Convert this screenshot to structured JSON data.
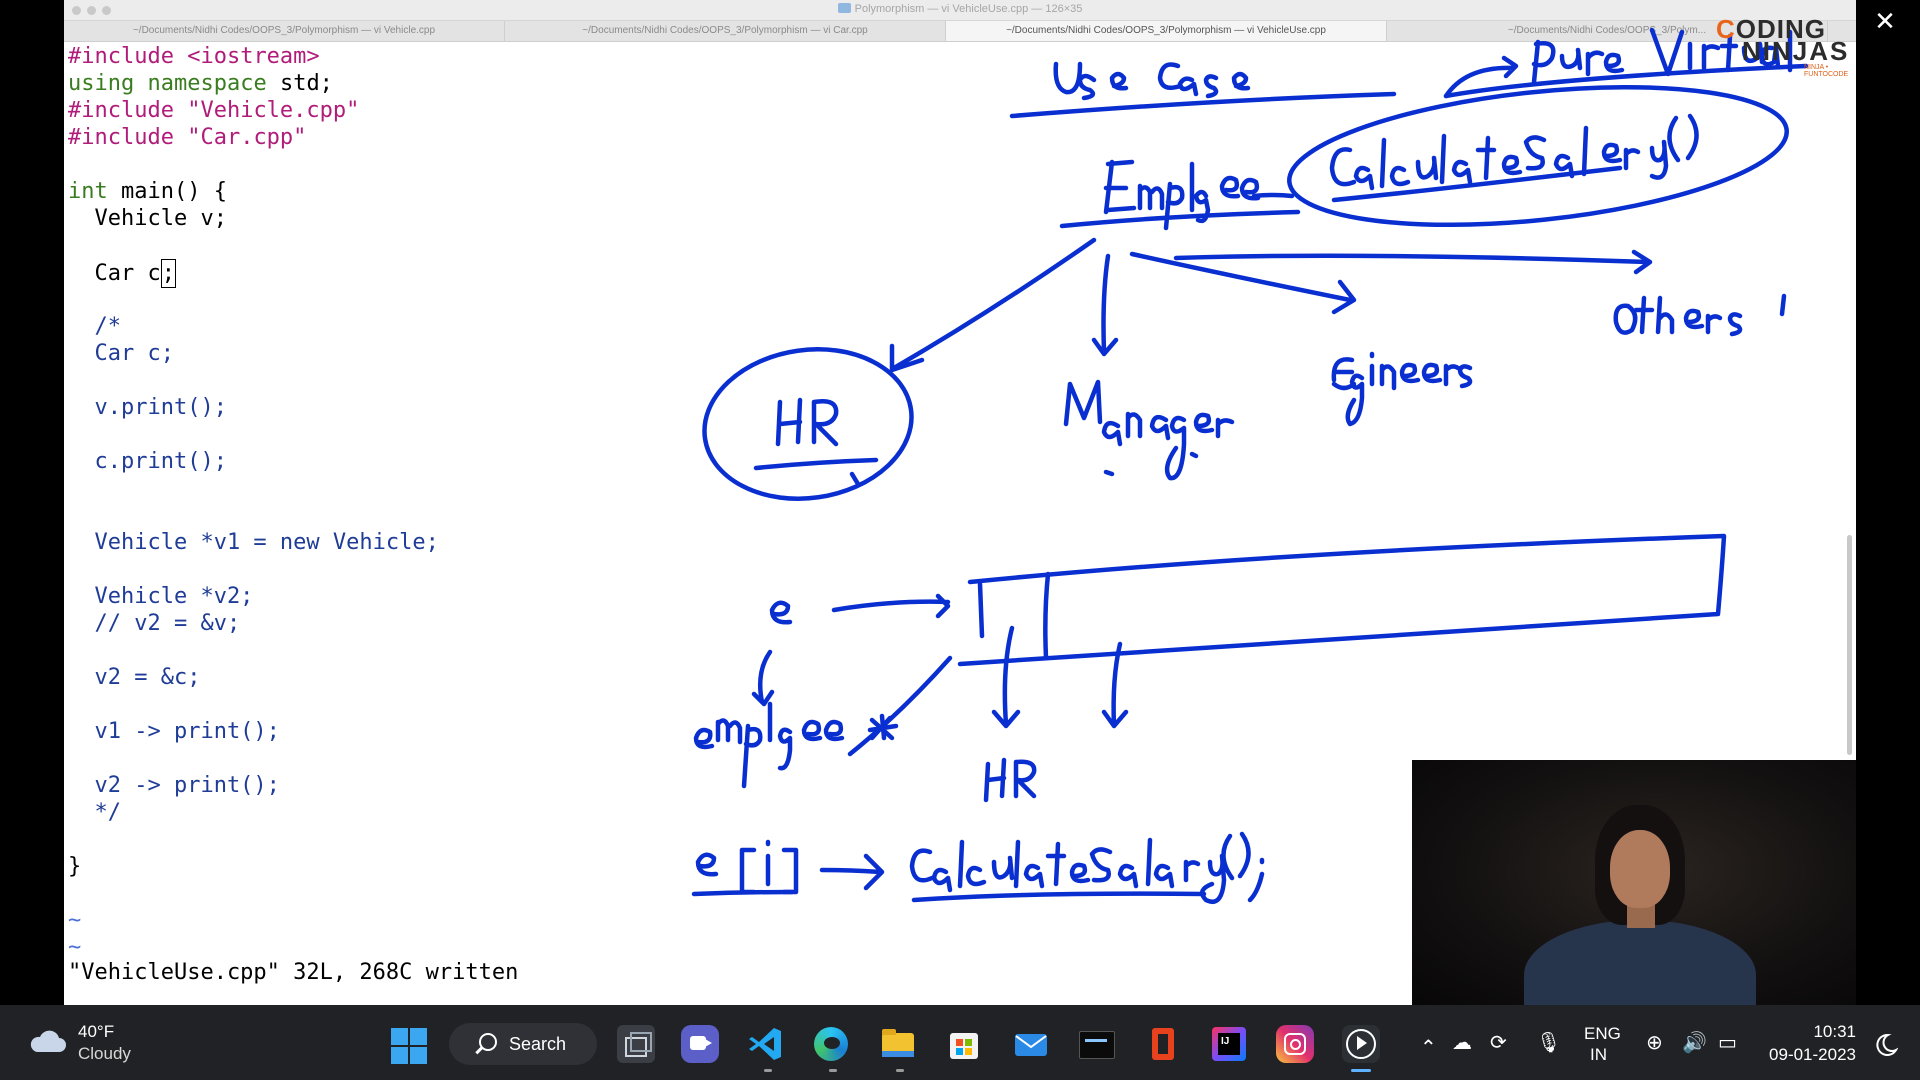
{
  "window": {
    "title": "Polymorphism — vi VehicleUse.cpp — 126×35",
    "tabs": [
      {
        "label": "~/Documents/Nidhi Codes/OOPS_3/Polymorphism — vi Vehicle.cpp",
        "active": false
      },
      {
        "label": "~/Documents/Nidhi Codes/OOPS_3/Polymorphism — vi Car.cpp",
        "active": false
      },
      {
        "label": "~/Documents/Nidhi Codes/OOPS_3/Polymorphism — vi VehicleUse.cpp",
        "active": true
      },
      {
        "label": "~/Documents/Nidhi Codes/OOPS_3/Polym...",
        "active": false
      }
    ]
  },
  "code": {
    "l01a": "#include",
    "l01b": " <iostream>",
    "l02a": "using",
    "l02b": " ",
    "l02c": "namespace",
    "l02d": " std;",
    "l03a": "#include",
    "l03b": " \"Vehicle.cpp\"",
    "l04a": "#include",
    "l04b": " \"Car.cpp\"",
    "l06a": "int",
    "l06b": " main() {",
    "l07": "  Vehicle v;",
    "l09a": "  Car c",
    "l09b": ";",
    "l11": "  /*",
    "l12": "  Car c;",
    "l14": "  v.print();",
    "l16": "  c.print();",
    "l19": "  Vehicle *v1 = new Vehicle;",
    "l21": "  Vehicle *v2;",
    "l22": "  // v2 = &v;",
    "l24": "  v2 = &c;",
    "l26": "  v1 -> print();",
    "l28": "  v2 -> print();",
    "l29": "  */",
    "l31": "}",
    "tilde": "~"
  },
  "status_line": "\"VehicleUse.cpp\" 32L, 268C written",
  "logo": {
    "line1a": "C",
    "line1b": "ODING",
    "line2": "NINJAS",
    "tagline": "NINJA • FUNTOCODE"
  },
  "taskbar": {
    "weather_temp": "40°F",
    "weather_cond": "Cloudy",
    "search_label": "Search",
    "lang_line1": "ENG",
    "lang_line2": "IN",
    "time": "10:31",
    "date": "09-01-2023"
  },
  "colors": {
    "ink": "#0a2fd1",
    "accent": "#3aa7f0"
  }
}
